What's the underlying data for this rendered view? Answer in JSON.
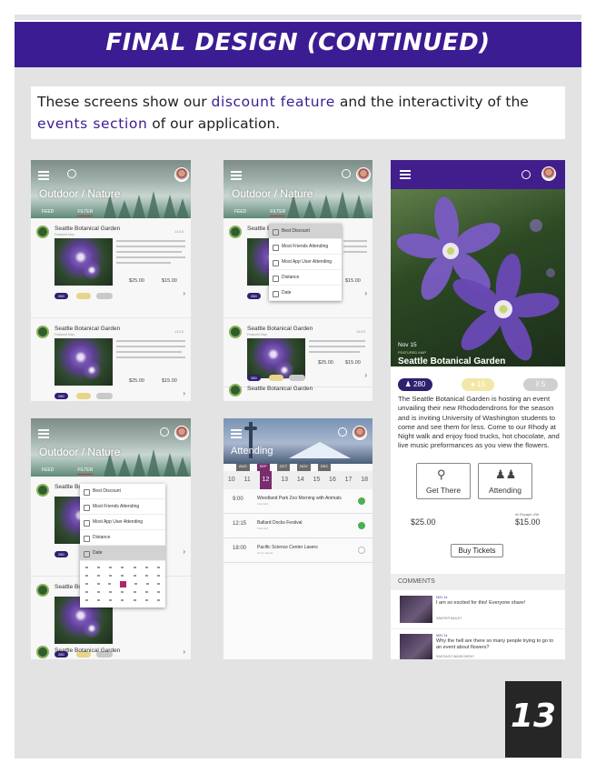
{
  "banner": {
    "title": "FINAL DESIGN (CONTINUED)"
  },
  "intro": {
    "part1": "These screens show our ",
    "highlight1": "discount feature",
    "part2": " and the interactivity of the ",
    "highlight2": "events section",
    "part3": " of our application."
  },
  "feed": {
    "hero_title": "Outdoor / Nature",
    "tab_feed": "FEED",
    "tab_filter": "FILTER",
    "card_name": "Seattle Botanical Garden",
    "card_sub": "Featured Map",
    "card_date": "11/15",
    "price_regular": "$25.00",
    "price_discount": "$15.00",
    "price_note": "w/ Escape UW",
    "likes": "280",
    "comments": "15",
    "shares": "5",
    "card_name_bottom": "Seattle Botanical Garden"
  },
  "filter_menu": {
    "items": [
      "Best Discount",
      "Most Friends Attending",
      "Most App User Attending",
      "Distance",
      "Date"
    ]
  },
  "attending": {
    "title": "Attending",
    "dates": [
      "10",
      "11",
      "12",
      "13",
      "14",
      "15",
      "16",
      "17",
      "18"
    ],
    "selected_date": "12",
    "months": [
      "AUG",
      "SEP",
      "OCT",
      "NOV",
      "DEC"
    ],
    "events": [
      {
        "time": "9:00",
        "name": "Woodland Park Zoo Morning with Animals",
        "sub": "Attended",
        "attended": true
      },
      {
        "time": "12:15",
        "name": "Ballard Docks Festival",
        "sub": "Attended",
        "attended": true
      },
      {
        "time": "18:00",
        "name": "Pacific Science Center Lasers",
        "sub": "Not to attend",
        "attended": false
      }
    ]
  },
  "detail": {
    "date": "Nov 15",
    "org_tag": "FEATURED MAP",
    "name": "Seattle Botanical Garden",
    "stats": {
      "likes": "280",
      "comments": "15",
      "shares": "5"
    },
    "description": "The Seattle Botanical Garden is hosting an event unvailing their new Rhododendrons for the season and is inviting University of Washington students to come and see them for less. Come to our Rhody at Night walk and enjoy food trucks, hot chocolate, and live music preformances as you view the flowers.",
    "get_there": "Get There",
    "attending": "Attending",
    "price_regular": "$25.00",
    "price_note": "w/ Escape UW",
    "price_discount": "$15.00",
    "buy": "Buy Tickets",
    "comments_header": "COMMENTS",
    "comments": [
      {
        "meta": "NOV 14",
        "text": "I am so excited for this! Everyone share!",
        "user": "SAWYER BAILEY"
      },
      {
        "meta": "NOV 14",
        "text": "Why the hell are there so many people trying to go to an event about flowers?",
        "user": "SANTIAGO WASKOWSKY"
      }
    ]
  },
  "page_number": "13",
  "colors": {
    "brand_purple": "#3b1c93",
    "accent_magenta": "#7a2d6e",
    "like_pill": "#2e2170",
    "comment_pill": "#e8d48a",
    "attended_green": "#4caf50"
  }
}
